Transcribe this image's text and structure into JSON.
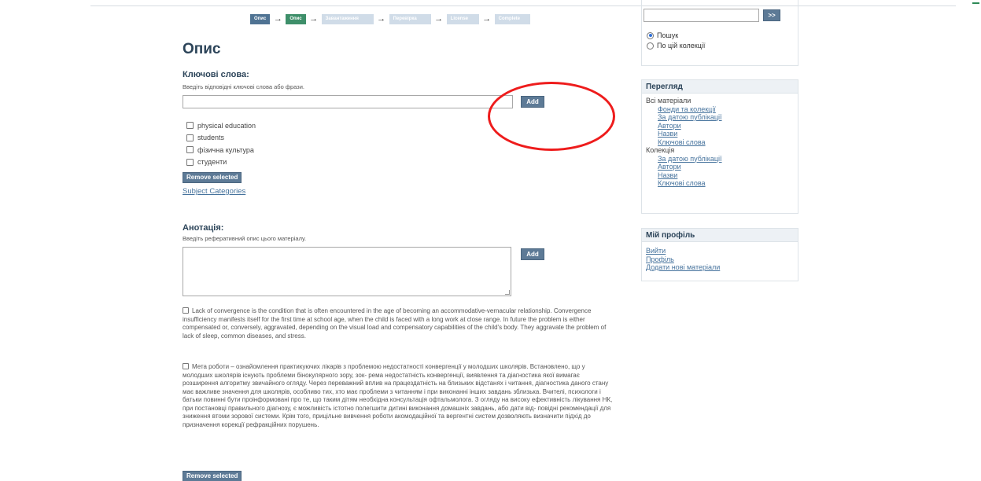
{
  "progress": {
    "steps": [
      {
        "label": "Опис",
        "state": "done"
      },
      {
        "label": "Опис",
        "state": "current"
      },
      {
        "label": "Завантаження",
        "state": "todo"
      },
      {
        "label": "Перевірка",
        "state": "todo"
      },
      {
        "label": "License",
        "state": "todo"
      },
      {
        "label": "Complete",
        "state": "todo"
      }
    ],
    "arrow": "→"
  },
  "page": {
    "title": "Опис"
  },
  "keywords": {
    "label": "Ключові слова:",
    "help": "Введіть відповідні ключові слова або фрази.",
    "add_label": "Add",
    "items": [
      "physical education",
      "students",
      "фізична культура",
      "студенти"
    ],
    "remove_label": "Remove selected",
    "categories_link": "Subject Categories"
  },
  "abstract": {
    "label": "Анотація:",
    "help": "Введіть реферативний опис цього матеріалу.",
    "add_label": "Add",
    "entries": [
      "Lack of convergence is the condition that is often encountered in the age of becoming an accommodative-vernacular relationship. Convergence insufficiency manifests itself for the first time at school age, when the child is faced with a long work at close range. In future the problem is either compensated or, conversely, aggravated, depending on the visual load and compensatory capabilities of the child's body. They aggravate the problem of lack of sleep, common diseases, and stress.",
      "Мета роботи – ознайомлення практикуючих лікарів з проблемою недостатності конвергенції у молодших школярів. Встановлено, що у молодших школярів існують проблеми бінокулярного зору, зок- рема недостатність конвергенції, виявлення та діагностика якої вимагає розширення алгоритму звичайного огляду. Через переважний вплив на працездатність на близьких відстанях і читання, діагностика даного стану має важливе значення для школярів, особливо тих, хто має проблеми з читанням і при виконанні інших завдань зблизька. Вчителі, психологи і батьки повинні бути проінформовані про те, що таким дітям необхідна консультація офтальмолога. З огляду на високу ефективність лікування НК, при постановці правильного діагнозу, є можливість істотно полегшити дитині виконання домашніх завдань, або дати від- повідні рекомендації для зниження втоми зорової системи. Крім того, прицільне вивчення роботи акомодаційної та вергентні систем дозволяють визначити підхід до призначення корекції рефракційних порушень."
    ],
    "remove_label": "Remove selected"
  },
  "sidebar": {
    "search": {
      "go_label": ">>",
      "scope_all": "Пошук",
      "scope_collection": "По цій колекції"
    },
    "browse": {
      "title": "Перегляд",
      "group_all": "Всі матеріали",
      "all_links": [
        "Фонди та колекції",
        "За датою публікації",
        "Автори",
        "Назви",
        "Ключові слова"
      ],
      "group_collection": "Колекція",
      "collection_links": [
        "За датою публікації",
        "Автори",
        "Назви",
        "Ключові слова"
      ]
    },
    "profile": {
      "title": "Мій профіль",
      "links": [
        "Вийти",
        "Профіль",
        "Додати нові матеріали"
      ]
    }
  },
  "colors": {
    "accent": "#5d7a96",
    "current_step": "#3e8f6a",
    "heading": "#2c4459",
    "annotation": "#ee1c1c"
  }
}
